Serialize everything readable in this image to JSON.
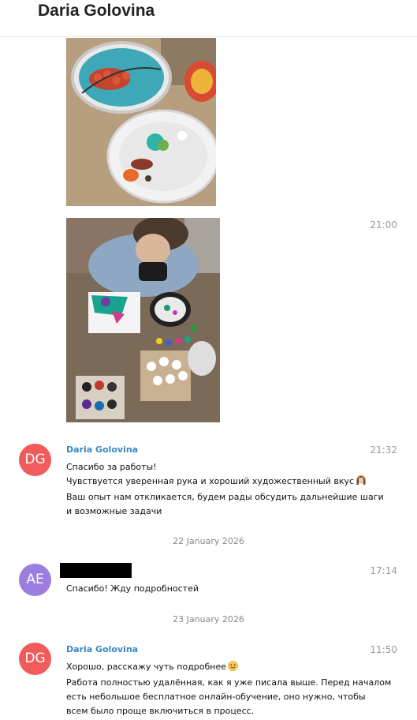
{
  "header": {
    "title": "Daria Golovina"
  },
  "images": [
    {
      "name": "painted-plate-photo"
    },
    {
      "name": "girl-painting-photo",
      "time": "21:00"
    }
  ],
  "messages": [
    {
      "avatar": "DG",
      "avatar_color": "#f25b5b",
      "sender": "Daria Golovina",
      "time": "21:32",
      "lines": [
        "Спасибо за работы!",
        "Чувствуется уверенная рука и хороший художественный вкус",
        "Ваш опыт нам откликается, будем рады обсудить дальнейшие шаги",
        "и возможные задачи"
      ]
    },
    {
      "date": "22 January 2026",
      "avatar": "AE",
      "avatar_color": "#9b7ee0",
      "sender_redacted": true,
      "time": "17:14",
      "lines": [
        "Спасибо! Жду подробностей"
      ]
    },
    {
      "date": "23 January 2026",
      "avatar": "DG",
      "avatar_color": "#f25b5b",
      "sender": "Daria Golovina",
      "time": "11:50",
      "lines": [
        "Хорошо, расскажу чуть подробнее",
        "Работа полностью удалённая, как я уже писала выше. Перед началом",
        "есть небольшое бесплатное онлайн-обучение, оно нужно, чтобы",
        "всем было проще включиться в процесс."
      ]
    }
  ],
  "colors": {
    "sender": "#3a88c0",
    "date": "#888888",
    "time": "#999999"
  },
  "icons": [
    "woman-facepalm-emoji",
    "smiling-face-emoji"
  ]
}
